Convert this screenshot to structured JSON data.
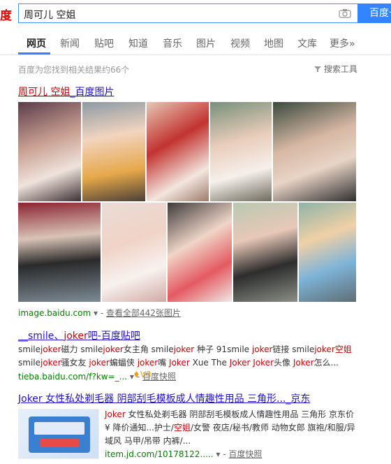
{
  "header": {
    "logo_text": "度",
    "query": "周可儿 空姐",
    "search_button": "百度一下"
  },
  "tabs": [
    {
      "label": "网页",
      "active": true
    },
    {
      "label": "新闻"
    },
    {
      "label": "贴吧"
    },
    {
      "label": "知道"
    },
    {
      "label": "音乐"
    },
    {
      "label": "图片"
    },
    {
      "label": "视频"
    },
    {
      "label": "地图"
    },
    {
      "label": "文库"
    },
    {
      "label": "更多»"
    }
  ],
  "result_count": "百度为您找到相关结果约66个",
  "search_tools": "搜索工具",
  "results": {
    "r1": {
      "title_em": "周可儿 空姐",
      "title_rest": "_百度图片",
      "source": "image.baidu.com",
      "more": "查看全部442张图片"
    },
    "r2": {
      "title_pre": "__smile、",
      "title_em": "joker",
      "title_rest": "吧-百度贴吧",
      "abs1": [
        "smile",
        "joker",
        "磁力 smile",
        "joker",
        "女主角 smile",
        "joker",
        " 种子 91smile ",
        "joker",
        "链接 smile",
        "joker",
        "空姐"
      ],
      "abs2": [
        "smile",
        "joker",
        "骚女友 ",
        "joker",
        "蝙蝠侠 ",
        "joker",
        "嘴 ",
        "Joker",
        " Xue The ",
        "Joker",
        " ",
        "Joker",
        "头像 ",
        "Joker",
        "怎么..."
      ],
      "source": "tieba.baidu.com/f?kw=_...",
      "snapshot": "百度快照"
    },
    "r3": {
      "title": "Joker 女性私处剃毛器 阴部刮毛模板成人情趣性用品 三角形..._京东",
      "abs1": [
        "Joker",
        " 女性私处剃毛器 阴部刮毛模板成人情趣性用品 三角形 京东价"
      ],
      "abs2": [
        "¥ 降价通知...护士/",
        "空姐",
        "/女警 夜店/秘书/教师 动物女郎 旗袍/和服/异"
      ],
      "abs3": "域风 马甲/吊带 内裤/...",
      "source": "item.jd.com/10178122.....",
      "snapshot": "百度快照",
      "vip": "V3"
    }
  }
}
